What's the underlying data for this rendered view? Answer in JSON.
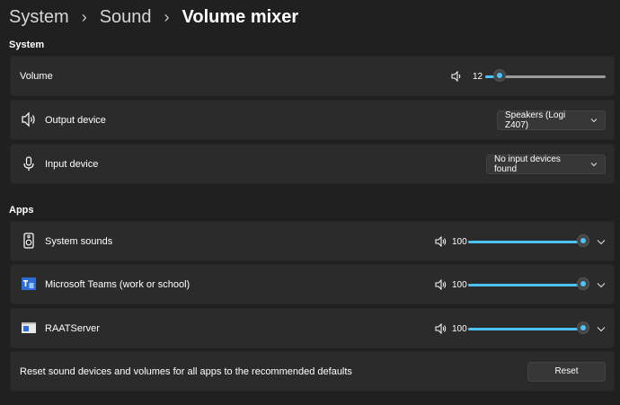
{
  "breadcrumb": {
    "items": [
      "System",
      "Sound",
      "Volume mixer"
    ]
  },
  "system": {
    "title": "System",
    "volume": {
      "label": "Volume",
      "value": "12",
      "level": 0.12
    },
    "output": {
      "label": "Output device",
      "selected": "Speakers (Logi Z407)"
    },
    "input": {
      "label": "Input device",
      "selected": "No input devices found"
    }
  },
  "apps": {
    "title": "Apps",
    "items": [
      {
        "label": "System sounds",
        "value": "100",
        "level": 1.0
      },
      {
        "label": "Microsoft Teams (work or school)",
        "value": "100",
        "level": 1.0
      },
      {
        "label": "RAATServer",
        "value": "100",
        "level": 1.0
      }
    ]
  },
  "reset": {
    "text": "Reset sound devices and volumes for all apps to the recommended defaults",
    "button": "Reset"
  },
  "colors": {
    "accent": "#4cc2ff",
    "background": "#202020",
    "card": "#2b2b2b"
  }
}
